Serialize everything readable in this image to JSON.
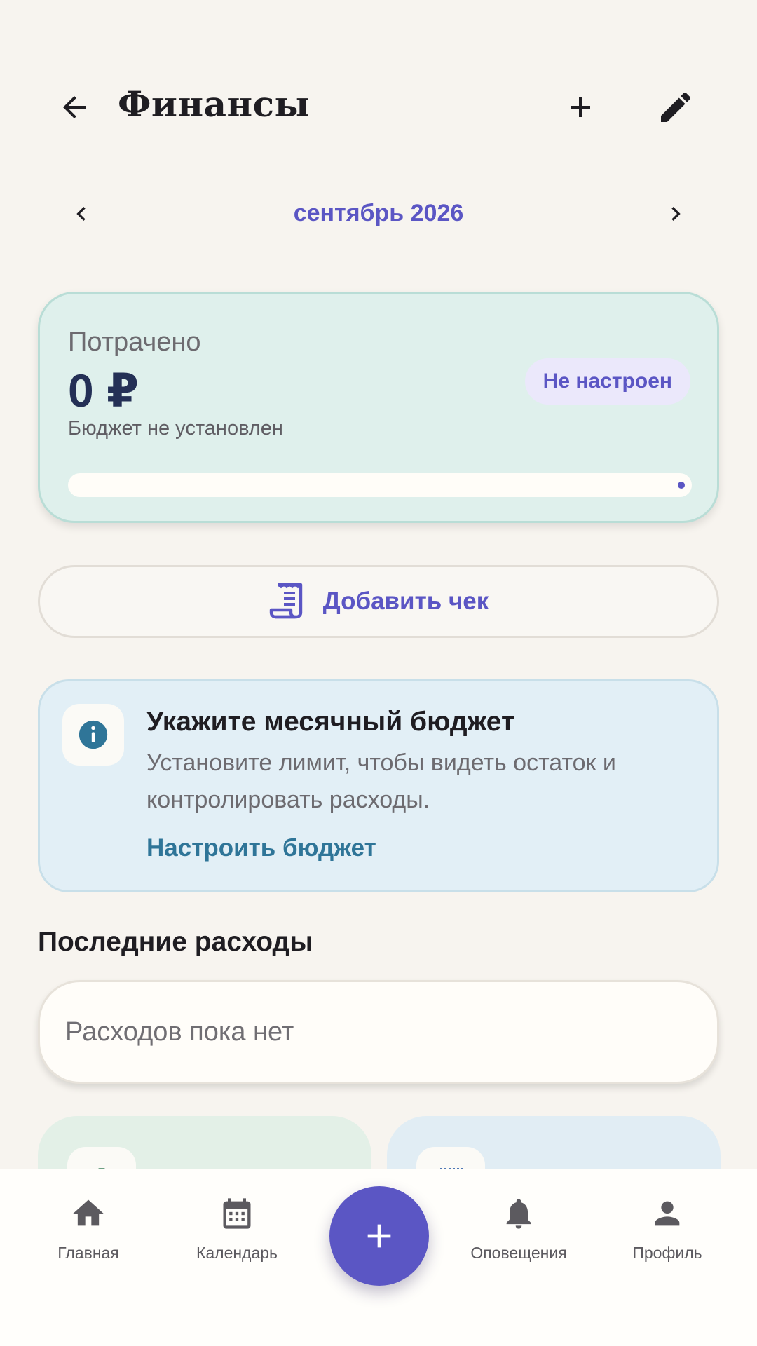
{
  "header": {
    "title": "Финансы",
    "back_icon": "arrow-left-icon",
    "add_icon": "plus-icon",
    "edit_icon": "pencil-icon"
  },
  "month": {
    "label": "сентябрь 2026"
  },
  "spent": {
    "label": "Потрачено",
    "amount": "0 ₽",
    "subtitle": "Бюджет не установлен",
    "status": "Не настроен",
    "progress": 0
  },
  "add_receipt": {
    "label": "Добавить чек",
    "icon": "receipt-icon"
  },
  "budget_prompt": {
    "title": "Укажите месячный бюджет",
    "text": "Установите лимит, чтобы видеть остаток и контролировать расходы.",
    "link": "Настроить бюджет",
    "icon": "info-icon"
  },
  "recent": {
    "title": "Последние расходы",
    "empty_text": "Расходов пока нет"
  },
  "nav": {
    "items": [
      {
        "label": "Главная",
        "icon": "home-icon"
      },
      {
        "label": "Календарь",
        "icon": "calendar-icon"
      },
      {
        "label": "Оповещения",
        "icon": "bell-icon"
      },
      {
        "label": "Профиль",
        "icon": "profile-icon"
      }
    ],
    "fab_icon": "plus-icon"
  },
  "colors": {
    "accent": "#5b56c4",
    "background": "#f7f4ef",
    "spent_card": "#dff0ec",
    "info_card": "#e2eff6",
    "info_link": "#2f7598"
  }
}
